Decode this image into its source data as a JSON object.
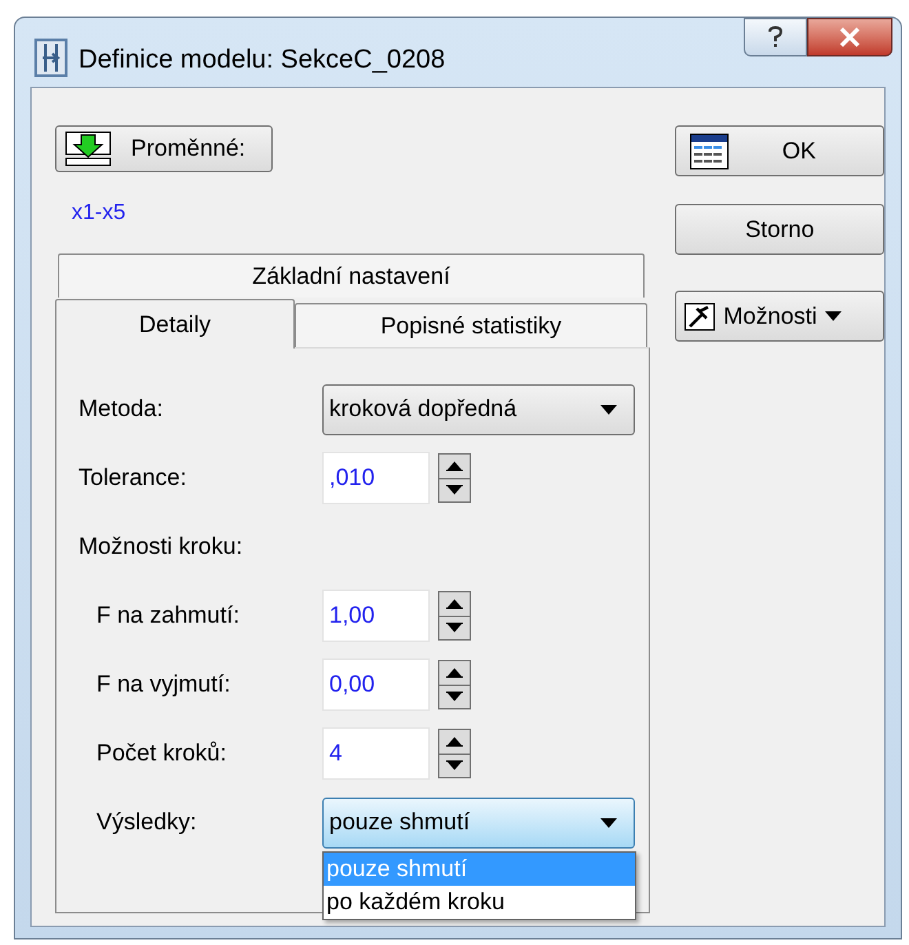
{
  "window": {
    "title": "Definice modelu: SekceC_0208"
  },
  "variables_button": {
    "label": "Proměnné:"
  },
  "variables_value": "x1-x5",
  "buttons": [
    {
      "kind": "ok",
      "label": "OK"
    },
    {
      "kind": "plain",
      "label": "Storno"
    },
    {
      "kind": "menu",
      "label": "Možnosti"
    }
  ],
  "tab_rows": [
    [
      {
        "label": "Základní nastavení",
        "selected": false
      }
    ],
    [
      {
        "label": "Detaily",
        "selected": true
      },
      {
        "label": "Popisné statistiky",
        "selected": false
      }
    ]
  ],
  "fields": [
    {
      "kind": "select",
      "label": "Metoda:",
      "value": "kroková dopředná"
    },
    {
      "kind": "spin",
      "label": "Tolerance:",
      "value": ",010"
    },
    {
      "kind": "group",
      "label": "Možnosti kroku:",
      "children": [
        {
          "kind": "spin",
          "label": "F na zahmutí:",
          "value": "1,00"
        },
        {
          "kind": "spin",
          "label": "F na vyjmutí:",
          "value": "0,00"
        },
        {
          "kind": "spin",
          "label": "Počet kroků:",
          "value": "4"
        },
        {
          "kind": "select",
          "label": "Výsledky:",
          "value": "pouze shmutí",
          "open": true,
          "options": [
            {
              "label": "pouze shmutí",
              "selected": true
            },
            {
              "label": "po každém kroku",
              "selected": false
            }
          ]
        }
      ]
    }
  ]
}
